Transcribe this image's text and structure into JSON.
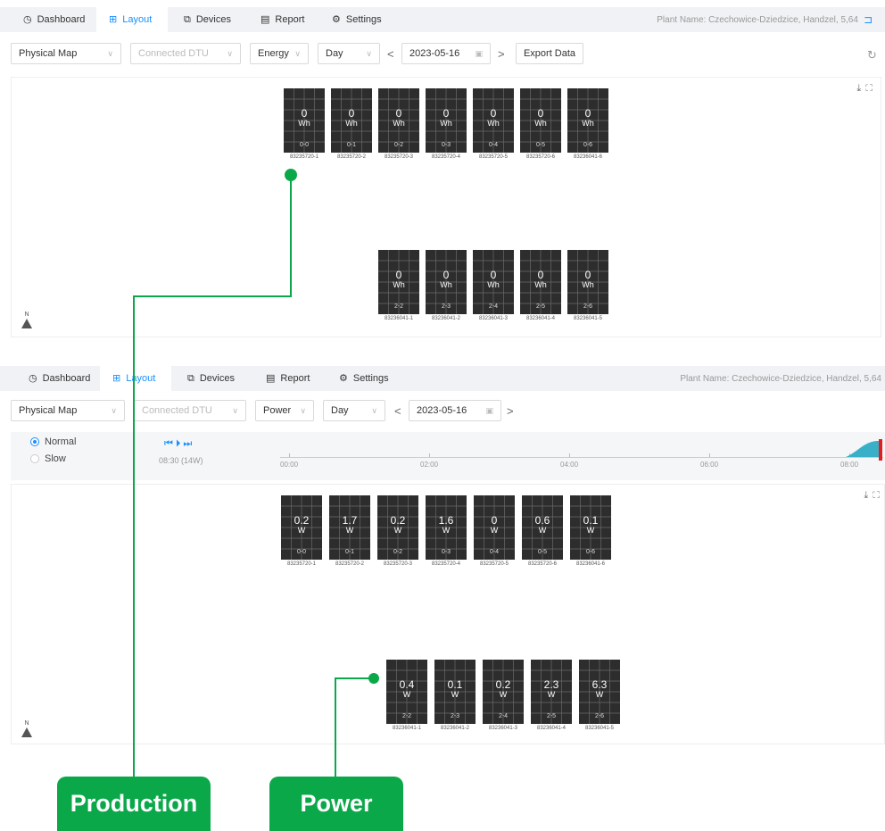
{
  "tabs": [
    {
      "label": "Dashboard",
      "icon": "dashboard-icon"
    },
    {
      "label": "Layout",
      "icon": "layout-icon"
    },
    {
      "label": "Devices",
      "icon": "devices-icon"
    },
    {
      "label": "Report",
      "icon": "report-icon"
    },
    {
      "label": "Settings",
      "icon": "settings-icon"
    }
  ],
  "plant_name": "Plant Name: Czechowice-Dziedzice, Handzel, 5,64",
  "top": {
    "map_type": "Physical Map",
    "dtu_placeholder": "Connected DTU",
    "metric": "Energy",
    "period": "Day",
    "date": "2023-05-16",
    "export_label": "Export Data",
    "row1": [
      {
        "value": "0",
        "unit": "Wh",
        "pos": "0-0",
        "id": "83235720-1"
      },
      {
        "value": "0",
        "unit": "Wh",
        "pos": "0-1",
        "id": "83235720-2"
      },
      {
        "value": "0",
        "unit": "Wh",
        "pos": "0-2",
        "id": "83235720-3"
      },
      {
        "value": "0",
        "unit": "Wh",
        "pos": "0-3",
        "id": "83235720-4"
      },
      {
        "value": "0",
        "unit": "Wh",
        "pos": "0-4",
        "id": "83235720-5"
      },
      {
        "value": "0",
        "unit": "Wh",
        "pos": "0-5",
        "id": "83235720-6"
      },
      {
        "value": "0",
        "unit": "Wh",
        "pos": "0-6",
        "id": "83236041-6"
      }
    ],
    "row2": [
      {
        "value": "0",
        "unit": "Wh",
        "pos": "2-2",
        "id": "83236041-1"
      },
      {
        "value": "0",
        "unit": "Wh",
        "pos": "2-3",
        "id": "83236041-2"
      },
      {
        "value": "0",
        "unit": "Wh",
        "pos": "2-4",
        "id": "83236041-3"
      },
      {
        "value": "0",
        "unit": "Wh",
        "pos": "2-5",
        "id": "83236041-4"
      },
      {
        "value": "0",
        "unit": "Wh",
        "pos": "2-6",
        "id": "83236041-5"
      }
    ]
  },
  "bottom": {
    "map_type": "Physical Map",
    "dtu_placeholder": "Connected DTU",
    "metric": "Power",
    "period": "Day",
    "date": "2023-05-16",
    "speed_normal": "Normal",
    "speed_slow": "Slow",
    "playback_time": "08:30 (14W)",
    "timeline_ticks": [
      "00:00",
      "02:00",
      "04:00",
      "06:00",
      "08:00"
    ],
    "row1": [
      {
        "value": "0.2",
        "unit": "W",
        "pos": "0-0",
        "id": "83235720-1"
      },
      {
        "value": "1.7",
        "unit": "W",
        "pos": "0-1",
        "id": "83235720-2"
      },
      {
        "value": "0.2",
        "unit": "W",
        "pos": "0-2",
        "id": "83235720-3"
      },
      {
        "value": "1.6",
        "unit": "W",
        "pos": "0-3",
        "id": "83235720-4"
      },
      {
        "value": "0",
        "unit": "W",
        "pos": "0-4",
        "id": "83235720-5"
      },
      {
        "value": "0.6",
        "unit": "W",
        "pos": "0-5",
        "id": "83235720-6"
      },
      {
        "value": "0.1",
        "unit": "W",
        "pos": "0-6",
        "id": "83236041-6"
      }
    ],
    "row2": [
      {
        "value": "0.4",
        "unit": "W",
        "pos": "2-2",
        "id": "83236041-1"
      },
      {
        "value": "0.1",
        "unit": "W",
        "pos": "2-3",
        "id": "83236041-2"
      },
      {
        "value": "0.2",
        "unit": "W",
        "pos": "2-4",
        "id": "83236041-3"
      },
      {
        "value": "2.3",
        "unit": "W",
        "pos": "2-5",
        "id": "83236041-4"
      },
      {
        "value": "6.3",
        "unit": "W",
        "pos": "2-6",
        "id": "83236041-5"
      }
    ]
  },
  "north_label": "N",
  "callouts": {
    "production": "Production",
    "power": "Power"
  },
  "colors": {
    "accent": "#1890ff",
    "callout": "#0ba84a",
    "panel": "#2d2d2d",
    "playhead": "#e02020",
    "area": "#3ab0c8"
  }
}
